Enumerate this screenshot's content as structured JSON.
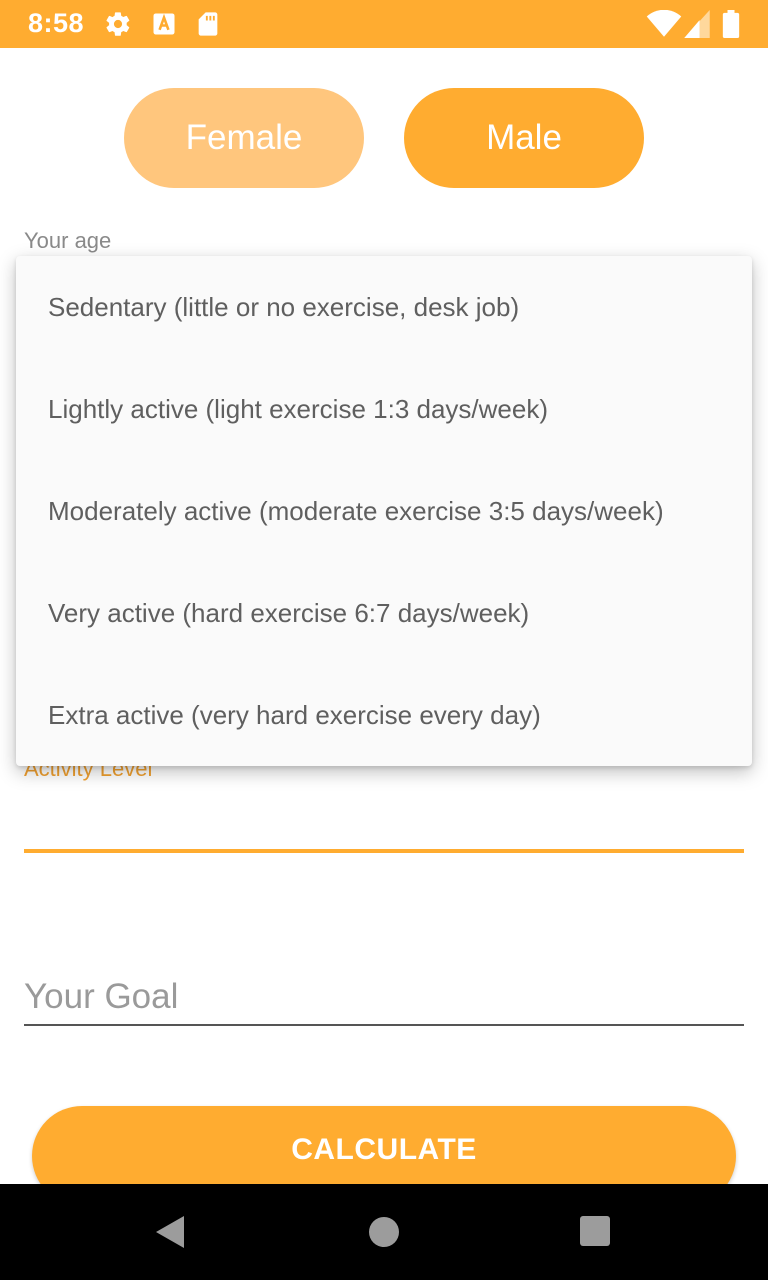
{
  "status_bar": {
    "time": "8:58",
    "icons": [
      "gear-icon",
      "text-a-icon",
      "sd-card-icon",
      "wifi-icon",
      "signal-icon",
      "battery-icon"
    ],
    "color": "#ffac30"
  },
  "gender": {
    "female_label": "Female",
    "male_label": "Male"
  },
  "age": {
    "label": "Your age"
  },
  "activity": {
    "label": "Activity Level",
    "options": [
      "Sedentary (little or no exercise, desk job)",
      "Lightly active (light exercise 1:3 days/week)",
      "Moderately active (moderate exercise 3:5 days/week)",
      "Very active (hard exercise 6:7 days/week)",
      "Extra active (very hard exercise every day)"
    ]
  },
  "goal": {
    "placeholder": "Your Goal",
    "value": ""
  },
  "calculate": {
    "label": "CALCULATE"
  },
  "nav_bar": {
    "icons": [
      "back-icon",
      "home-icon",
      "recents-icon"
    ]
  },
  "colors": {
    "accent": "#ffac30",
    "accent_light": "#ffc67d"
  }
}
